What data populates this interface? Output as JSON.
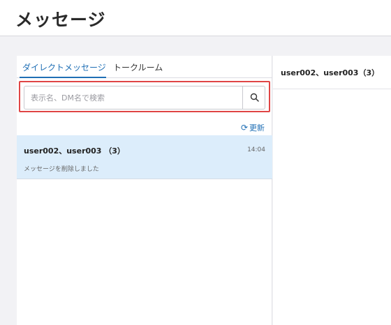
{
  "page": {
    "title": "メッセージ"
  },
  "tabs": [
    {
      "label": "ダイレクトメッセージ",
      "active": true
    },
    {
      "label": "トークルーム",
      "active": false
    }
  ],
  "search": {
    "placeholder": "表示名、DM名で検索",
    "value": "",
    "icon": "search-icon"
  },
  "refresh": {
    "label": "更新",
    "icon": "refresh-icon"
  },
  "conversations": [
    {
      "name": "user002、user003 （3）",
      "time": "14:04",
      "preview": "メッセージを削除しました",
      "selected": true
    }
  ],
  "detail": {
    "title": "user002、user003（3）"
  },
  "colors": {
    "accent": "#1f6fb5",
    "highlight_border": "#e04545",
    "selected_row": "#dcedfb"
  }
}
